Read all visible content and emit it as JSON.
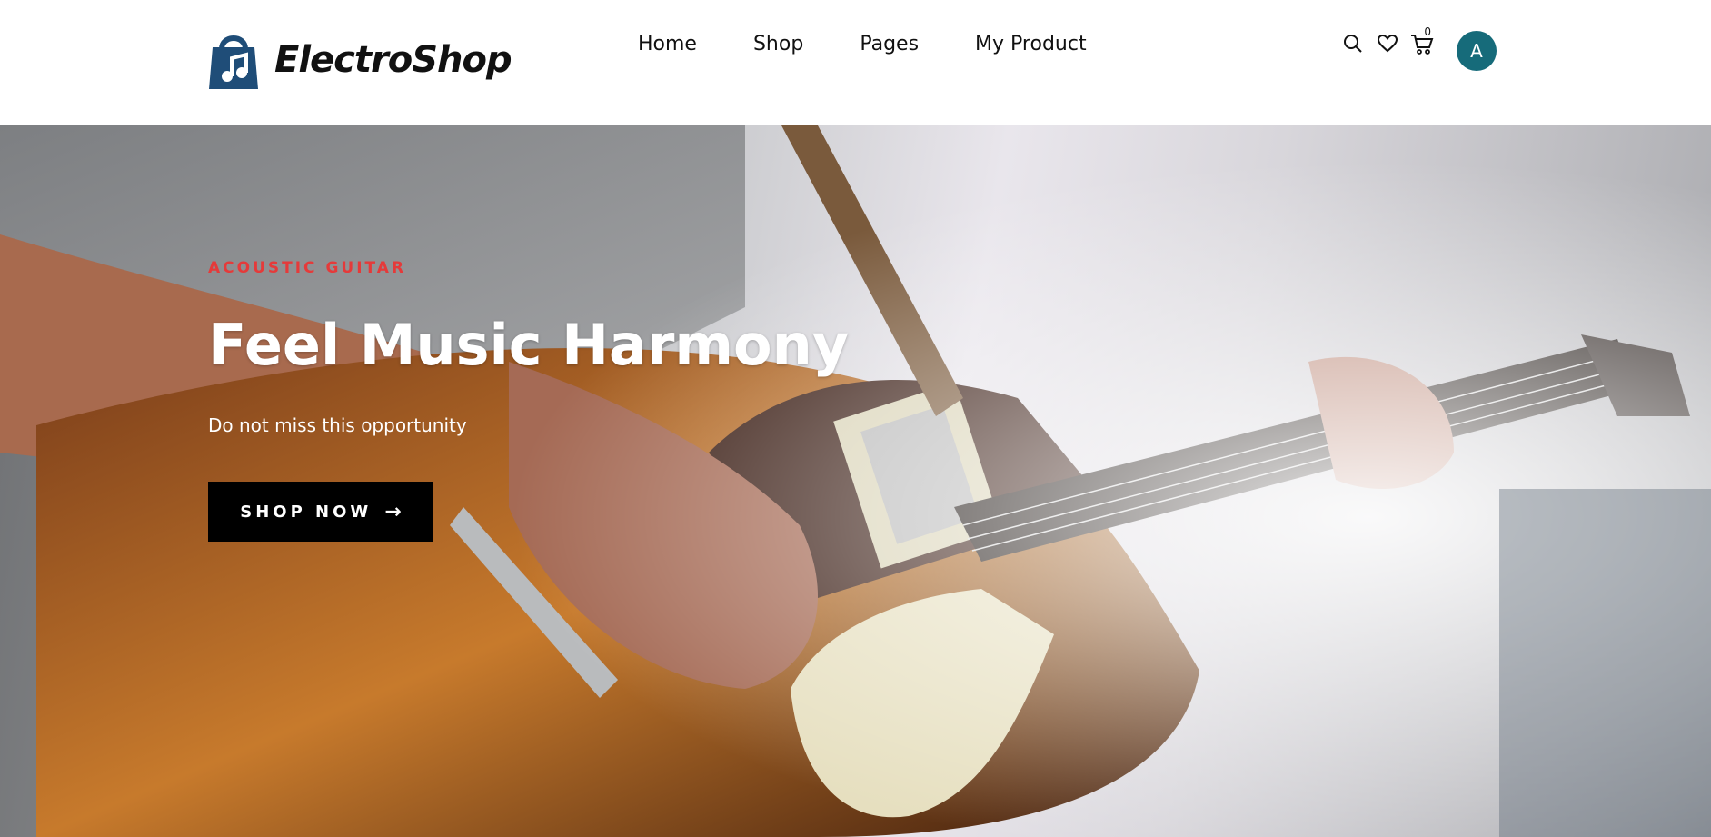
{
  "header": {
    "brand": "ElectroShop",
    "nav": [
      "Home",
      "Shop",
      "Pages",
      "My Product"
    ],
    "cart_count": "0",
    "avatar_initial": "A",
    "icons": [
      "search-icon",
      "heart-icon",
      "cart-icon"
    ]
  },
  "hero": {
    "eyebrow": "ACOUSTIC GUITAR",
    "headline": "Feel Music Harmony",
    "subline": "Do not miss this opportunity",
    "cta_label": "SHOP NOW",
    "cta_arrow": "→"
  },
  "colors": {
    "accent_red": "#e53a3a",
    "logo_blue": "#1f4d78",
    "avatar_teal": "#166b7a",
    "cta_bg": "#000000"
  }
}
